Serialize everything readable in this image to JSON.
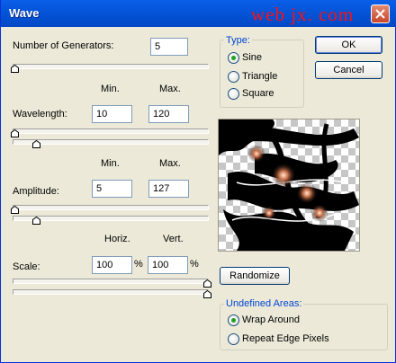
{
  "window": {
    "title": "Wave",
    "watermark": "web jx. com"
  },
  "generators": {
    "label": "Number of Generators:",
    "value": "5"
  },
  "columns": {
    "min": "Min.",
    "max": "Max.",
    "horiz": "Horiz.",
    "vert": "Vert."
  },
  "wavelength": {
    "label": "Wavelength:",
    "min": "10",
    "max": "120"
  },
  "amplitude": {
    "label": "Amplitude:",
    "min": "5",
    "max": "127"
  },
  "scale": {
    "label": "Scale:",
    "horiz": "100",
    "vert": "100",
    "unit": "%"
  },
  "type": {
    "title": "Type:",
    "options": [
      "Sine",
      "Triangle",
      "Square"
    ],
    "selected": "Sine"
  },
  "buttons": {
    "ok": "OK",
    "cancel": "Cancel",
    "randomize": "Randomize"
  },
  "undefined_areas": {
    "title": "Undefined Areas:",
    "options": [
      "Wrap Around",
      "Repeat Edge Pixels"
    ],
    "selected": "Wrap Around"
  },
  "colors": {
    "title_bar": "#0453d6",
    "accent": "#0046d5",
    "radio_dot": "#21a121",
    "watermark": "#ff1010"
  }
}
